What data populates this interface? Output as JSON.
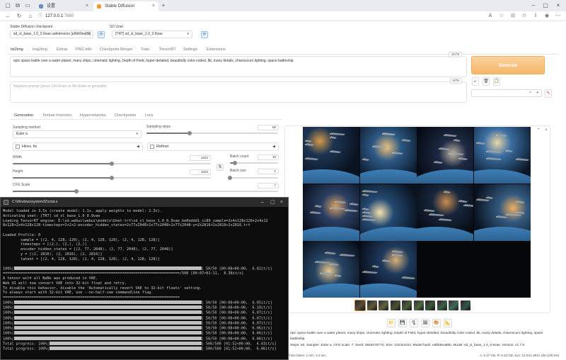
{
  "browser": {
    "tabs": [
      {
        "label": "设置"
      },
      {
        "label": "Stable Diffusion"
      }
    ],
    "new_tab": "+",
    "url_host": "127.0.0.1",
    "url_port": ":7860"
  },
  "header": {
    "checkpoint_label": "Stable Diffusion checkpoint",
    "checkpoint_value": "sd_xl_base_1.0_0.9vae.safetensors [e6bb9ea85]",
    "unet_label": "SD Unet",
    "unet_value": "[TRT] sd_xl_base_1.0_0.9vae"
  },
  "main_tabs": [
    "txt2img",
    "img2img",
    "Extras",
    "PNG Info",
    "Checkpoint Merger",
    "Train",
    "TensorRT",
    "Settings",
    "Extensions"
  ],
  "prompt": {
    "text": "epic space battle over a water planet, many ships, cinematic lighting, Depth of Field, hyper-detailed, beautifully color-coded, 8k, many details, chiaroscuro lighting, space battleship",
    "counter": "41/75",
    "negative_placeholder": "Negative prompt (press Ctrl+Enter or Alt+Enter to generate)",
    "negative_counter": "0/75"
  },
  "generate_label": "Generate",
  "sub_tabs": [
    "Generation",
    "Textual Inversion",
    "Hypernetworks",
    "Checkpoints",
    "Lora"
  ],
  "params": {
    "sampling_method_label": "Sampling method",
    "sampling_method": "Euler a",
    "sampling_steps_label": "Sampling steps",
    "sampling_steps": "50",
    "hires_label": "Hires. fix",
    "refiner_label": "Refiner",
    "width_label": "Width",
    "width": "1024",
    "height_label": "Height",
    "height": "1024",
    "batch_count_label": "Batch count",
    "batch_count": "10",
    "batch_size_label": "Batch size",
    "batch_size": "1",
    "cfg_label": "CFG Scale",
    "cfg": "7"
  },
  "slider_fractions": {
    "sampling_steps": 0.33,
    "width": 0.5,
    "height": 0.5,
    "batch_count": 0.1,
    "batch_size": 0.0,
    "cfg": 0.24
  },
  "gallery": {
    "grid_layout": "4 columns × 3 rows, 10 images",
    "thumbnail_count": 10,
    "info_lines": [
      "epic space battle over a water planet, many ships, cinematic lighting, Depth of Field, hyper-detailed, beautifully color-coded, 8k, many details, chiaroscuro lighting, space",
      "battleship",
      "Steps: 50, Sampler: Euler a, CFG scale: 7, Seed: 3925275770, Size: 1024x1024, Model hash: e6bb9ea85b, Model: sd_xl_base_1.0_0.9vae, Version: v1.7.0"
    ],
    "time_taken": "Time taken: 1 min. 3.3 sec.",
    "vram": "A: 6.37 GB, R: 8.33 GB, Sys: 12.0/11.9941 GB (100.0%)"
  },
  "console": {
    "title": "C:\\Windows\\system32\\cmd.e",
    "lines": [
      "Model loaded in 3.5s (create model: 1.1s, apply weights to model: 2.3s).",
      "Activating unet: [TRT] sd_xl_base_1.0_0.9vae",
      "Loading TensorRT engine: E:\\sd.webui\\webui\\models\\Unet-trt\\sd_xl_base_1.0_0.9vae_be0eddd1_cc89_sample=2x4x128x128+2x4x12",
      "8x128+2x4x128x128-timesteps=2+2+2-encoder_hidden_states=2x77x2048+2x77x2048+2x77x2048-y=2x2816+2x2816+2x2816.trt",
      "",
      "Loaded Profile: 0",
      "        sample = [(2, 4, 128, 128), (2, 4, 128, 128), (2, 4, 128, 128)]",
      "        timesteps = [(2,), (2,), (2,)]",
      "        encoder_hidden_states = [(2, 77, 2048), (2, 77, 2048), (2, 77, 2048)]",
      "        y = [(2, 2816), (2, 2816), (2, 2816)]",
      "        latent = [(2, 4, 128, 128), (2, 4, 128, 128), (2, 4, 128, 128)]",
      ""
    ],
    "progress_first": {
      "pct": "100%|",
      "tail": "| 50/50 [00:08<00:00,  6.02it/s]"
    },
    "sep": "================================================================================/500 [00:07<01:11,  6.38it/s]",
    "warnings": [
      "A tensor with all NaNs was produced in VAE.",
      "Web UI will now convert VAE into 32-bit float and retry.",
      "To disable this behavior, disable the 'Automatically revert VAE to 32-bit floats' setting.",
      "To always start with 32-bit VAE, use --no-half-vae commandline flag."
    ],
    "sep2": "================================================================================",
    "progress_rows": [
      {
        "pct": "100%|",
        "tail": "| 50/50 [00:08<00:00,  6.05it/s]"
      },
      {
        "pct": "100%|",
        "tail": "| 50/50 [00:08<00:00,  6.10it/s]"
      },
      {
        "pct": "100%|",
        "tail": "| 50/50 [00:08<00:00,  6.07it/s]"
      },
      {
        "pct": "100%|",
        "tail": "| 50/50 [00:08<00:00,  6.07it/s]"
      },
      {
        "pct": "100%|",
        "tail": "| 50/50 [00:08<00:00,  6.07it/s]"
      },
      {
        "pct": "100%|",
        "tail": "| 50/50 [00:08<00:00,  6.06it/s]"
      },
      {
        "pct": "100%|",
        "tail": "| 50/50 [00:08<00:00,  6.06it/s]"
      },
      {
        "pct": "100%|",
        "tail": "| 50/50 [00:08<00:00,  6.06it/s]"
      }
    ],
    "totals": [
      {
        "pct": "Total progress: 100%|",
        "tail": "| 500/500 [01:52<00:00,  4.43it/s]"
      },
      {
        "pct": "Total progress: 100%|",
        "tail": "| 500/500 [01:52<00:00,  6.06it/s]"
      }
    ]
  },
  "colors": {
    "accent": "#f6b76a",
    "link": "#2a6fc4",
    "console_bg": "#0c0c0c"
  }
}
